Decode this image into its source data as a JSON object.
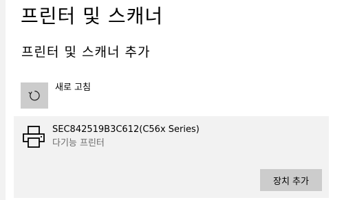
{
  "page": {
    "title": "프린터 및 스캐너"
  },
  "section": {
    "title": "프린터 및 스캐너 추가"
  },
  "refresh": {
    "icon": "refresh-icon",
    "label": "새로 고침"
  },
  "device": {
    "icon": "printer-icon",
    "name": "SEC842519B3C612(C56x Series)",
    "type": "다기능 프린터",
    "add_button_label": "장치 추가"
  },
  "colors": {
    "panel_background": "#f2f2f2",
    "button_background": "#cccccc",
    "secondary_text": "#6b6b6b"
  }
}
